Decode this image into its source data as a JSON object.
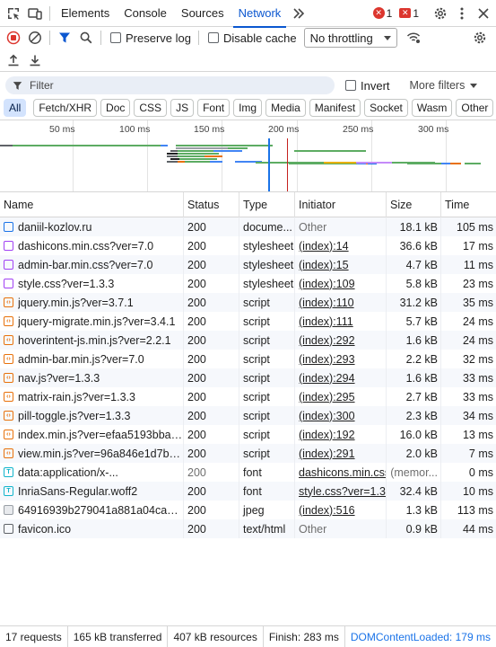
{
  "tabs": [
    {
      "label": "Elements",
      "active": false
    },
    {
      "label": "Console",
      "active": false
    },
    {
      "label": "Sources",
      "active": false
    },
    {
      "label": "Network",
      "active": true
    }
  ],
  "counters": {
    "errors": "1",
    "issues": "1"
  },
  "toolbar": {
    "preserve_log": "Preserve log",
    "disable_cache": "Disable cache",
    "throttling": "No throttling"
  },
  "filter": {
    "placeholder": "Filter",
    "invert": "Invert",
    "more_filters": "More filters"
  },
  "type_filters": [
    "All",
    "Fetch/XHR",
    "Doc",
    "CSS",
    "JS",
    "Font",
    "Img",
    "Media",
    "Manifest",
    "Socket",
    "Wasm",
    "Other"
  ],
  "overview": {
    "ticks": [
      "50 ms",
      "100 ms",
      "150 ms",
      "200 ms",
      "250 ms",
      "300 ms"
    ]
  },
  "columns": [
    "Name",
    "Status",
    "Type",
    "Initiator",
    "Size",
    "Time"
  ],
  "requests": [
    {
      "name": "daniil-kozlov.ru",
      "status": "200",
      "type": "docume...",
      "initiator": "Other",
      "initiator_link": false,
      "size": "18.1 kB",
      "time": "105 ms",
      "icon": "doc"
    },
    {
      "name": "dashicons.min.css?ver=7.0",
      "status": "200",
      "type": "stylesheet",
      "initiator": "(index):14",
      "initiator_link": true,
      "size": "36.6 kB",
      "time": "17 ms",
      "icon": "css"
    },
    {
      "name": "admin-bar.min.css?ver=7.0",
      "status": "200",
      "type": "stylesheet",
      "initiator": "(index):15",
      "initiator_link": true,
      "size": "4.7 kB",
      "time": "11 ms",
      "icon": "css"
    },
    {
      "name": "style.css?ver=1.3.3",
      "status": "200",
      "type": "stylesheet",
      "initiator": "(index):109",
      "initiator_link": true,
      "size": "5.8 kB",
      "time": "23 ms",
      "icon": "css"
    },
    {
      "name": "jquery.min.js?ver=3.7.1",
      "status": "200",
      "type": "script",
      "initiator": "(index):110",
      "initiator_link": true,
      "size": "31.2 kB",
      "time": "35 ms",
      "icon": "js"
    },
    {
      "name": "jquery-migrate.min.js?ver=3.4.1",
      "status": "200",
      "type": "script",
      "initiator": "(index):111",
      "initiator_link": true,
      "size": "5.7 kB",
      "time": "24 ms",
      "icon": "js"
    },
    {
      "name": "hoverintent-js.min.js?ver=2.2.1",
      "status": "200",
      "type": "script",
      "initiator": "(index):292",
      "initiator_link": true,
      "size": "1.6 kB",
      "time": "24 ms",
      "icon": "js"
    },
    {
      "name": "admin-bar.min.js?ver=7.0",
      "status": "200",
      "type": "script",
      "initiator": "(index):293",
      "initiator_link": true,
      "size": "2.2 kB",
      "time": "32 ms",
      "icon": "js"
    },
    {
      "name": "nav.js?ver=1.3.3",
      "status": "200",
      "type": "script",
      "initiator": "(index):294",
      "initiator_link": true,
      "size": "1.6 kB",
      "time": "33 ms",
      "icon": "js"
    },
    {
      "name": "matrix-rain.js?ver=1.3.3",
      "status": "200",
      "type": "script",
      "initiator": "(index):295",
      "initiator_link": true,
      "size": "2.7 kB",
      "time": "33 ms",
      "icon": "js"
    },
    {
      "name": "pill-toggle.js?ver=1.3.3",
      "status": "200",
      "type": "script",
      "initiator": "(index):300",
      "initiator_link": true,
      "size": "2.3 kB",
      "time": "34 ms",
      "icon": "js"
    },
    {
      "name": "index.min.js?ver=efaa5193bbad...",
      "status": "200",
      "type": "script",
      "initiator": "(index):192",
      "initiator_link": true,
      "size": "16.0 kB",
      "time": "13 ms",
      "icon": "js"
    },
    {
      "name": "view.min.js?ver=96a846e1d7b7...",
      "status": "200",
      "type": "script",
      "initiator": "(index):291",
      "initiator_link": true,
      "size": "2.0 kB",
      "time": "7 ms",
      "icon": "js"
    },
    {
      "name": "data:application/x-...",
      "status": "200",
      "type": "font",
      "initiator": "dashicons.min.css?",
      "initiator_link": true,
      "size": "(memor...",
      "time": "0 ms",
      "icon": "font",
      "muted": true
    },
    {
      "name": "InriaSans-Regular.woff2",
      "status": "200",
      "type": "font",
      "initiator": "style.css?ver=1.3.3",
      "initiator_link": true,
      "size": "32.4 kB",
      "time": "10 ms",
      "icon": "font"
    },
    {
      "name": "64916939b279041a881a04ca0a...",
      "status": "200",
      "type": "jpeg",
      "initiator": "(index):516",
      "initiator_link": true,
      "size": "1.3 kB",
      "time": "113 ms",
      "icon": "img"
    },
    {
      "name": "favicon.ico",
      "status": "200",
      "type": "text/html",
      "initiator": "Other",
      "initiator_link": false,
      "size": "0.9 kB",
      "time": "44 ms",
      "icon": "other"
    }
  ],
  "status_bar": {
    "requests": "17 requests",
    "transferred": "165 kB transferred",
    "resources": "407 kB resources",
    "finish": "Finish: 283 ms",
    "dom_content_loaded": "DOMContentLoaded: 179 ms"
  },
  "colors": {
    "accent": "#0b57d0",
    "error": "#dc362e",
    "dcl_line": "#1a73e8",
    "load_line": "#c5221f"
  }
}
